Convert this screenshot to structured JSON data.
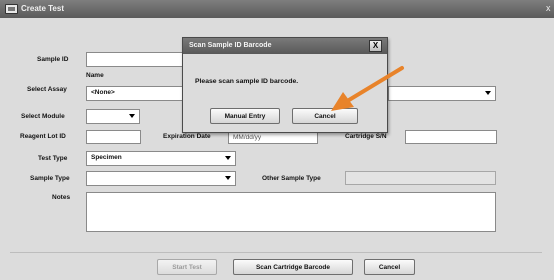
{
  "window": {
    "title": "Create Test",
    "close_glyph": "x"
  },
  "form": {
    "sample_id_label": "Sample ID",
    "name_label": "Name",
    "select_assay_label": "Select Assay",
    "select_assay_value": "<None>",
    "select_module_label": "Select Module",
    "select_module_value": "",
    "reagent_lot_label": "Reagent Lot ID",
    "expiration_label": "Expiration Date",
    "expiration_value": "MM/dd/yy",
    "cartridge_sn_label": "Cartridge S/N",
    "test_type_label": "Test Type",
    "test_type_value": "Specimen",
    "sample_type_label": "Sample Type",
    "sample_type_value": "",
    "other_sample_type_label": "Other Sample Type",
    "notes_label": "Notes"
  },
  "buttons": {
    "start_test": "Start Test",
    "scan_cartridge": "Scan Cartridge Barcode",
    "cancel": "Cancel"
  },
  "dialog": {
    "title": "Scan Sample ID Barcode",
    "close_glyph": "X",
    "message": "Please scan sample ID barcode.",
    "manual_entry": "Manual Entry",
    "cancel": "Cancel"
  },
  "annotation": {
    "arrow_color": "#e8832a",
    "points_to": "dialog-cancel-button"
  }
}
